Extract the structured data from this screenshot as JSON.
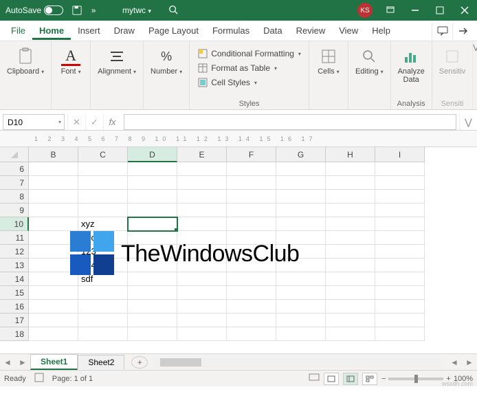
{
  "titlebar": {
    "autosave": "AutoSave",
    "more": "»",
    "doc": "mytwc",
    "docdrop": "▾",
    "avatar": "KS"
  },
  "menu": {
    "tabs": [
      "File",
      "Home",
      "Insert",
      "Draw",
      "Page Layout",
      "Formulas",
      "Data",
      "Review",
      "View",
      "Help"
    ]
  },
  "ribbon": {
    "clipboard": "Clipboard",
    "font": "Font",
    "alignment": "Alignment",
    "number": "Number",
    "styles": "Styles",
    "cf": "Conditional Formatting",
    "fat": "Format as Table",
    "cs": "Cell Styles",
    "cells": "Cells",
    "editing": "Editing",
    "analysis": "Analysis",
    "analyze": "Analyze Data",
    "sens": "Sensitiv",
    "sensg": "Sensiti"
  },
  "fbar": {
    "name": "D10",
    "fx": "fx"
  },
  "cols": [
    "B",
    "C",
    "D",
    "E",
    "F",
    "G",
    "H",
    "I"
  ],
  "rows": [
    "6",
    "7",
    "8",
    "9",
    "10",
    "11",
    "12",
    "13",
    "14",
    "15",
    "16",
    "17",
    "18"
  ],
  "cells": {
    "C10": "xyz",
    "C11": "abc",
    "C12": "123",
    "C13": "234",
    "C14": "sdf"
  },
  "ruler": "1 2 3 4 5 6 7 8 9 10 11 12 13 14 15 16 17",
  "watermark": "TheWindowsClub",
  "footwm": "wsxdh.com",
  "sheets": {
    "s1": "Sheet1",
    "s2": "Sheet2",
    "add": "+"
  },
  "status": {
    "ready": "Ready",
    "page": "Page: 1 of 1",
    "zoom": "100%",
    "minus": "−",
    "plus": "+"
  }
}
